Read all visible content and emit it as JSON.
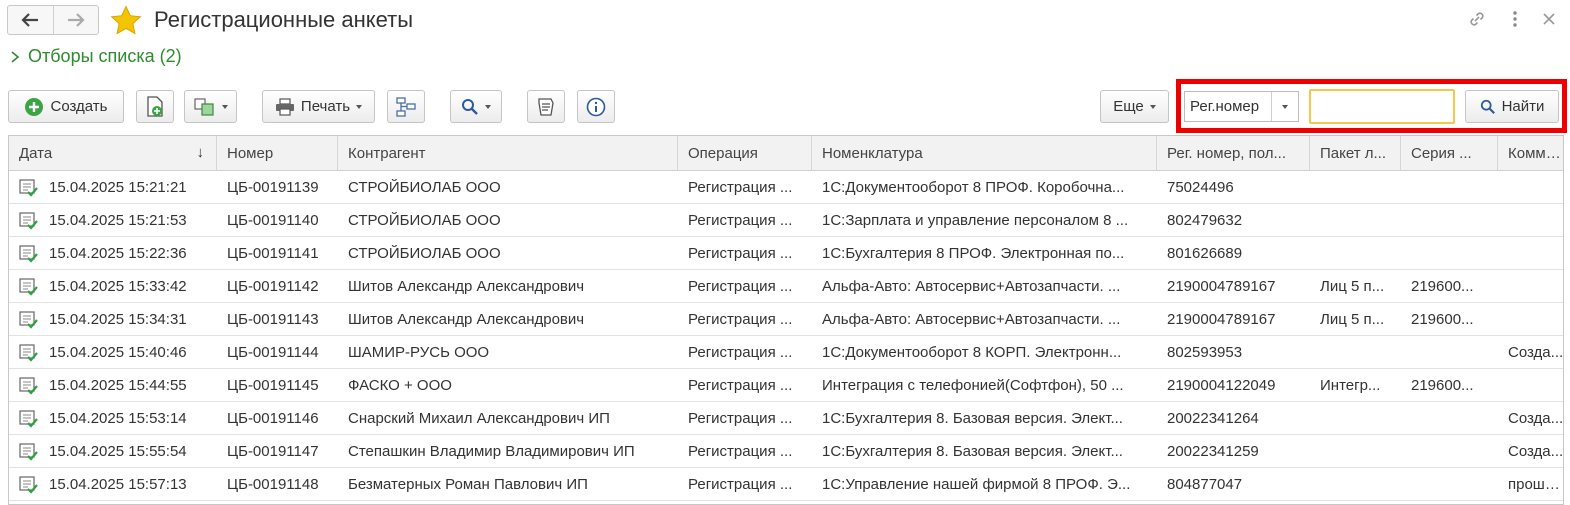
{
  "window": {
    "title": "Регистрационные анкеты",
    "filters_label": "Отборы списка (2)"
  },
  "toolbar": {
    "create_label": "Создать",
    "print_label": "Печать",
    "more_label": "Еще",
    "search_field_select": "Рег.номер",
    "search_value": "",
    "find_label": "Найти"
  },
  "table": {
    "headers": {
      "date": "Дата",
      "number": "Номер",
      "counterparty": "Контрагент",
      "operation": "Операция",
      "nomenclature": "Номенклатура",
      "regnum": "Рег. номер, пол...",
      "package": "Пакет л...",
      "series": "Серия ...",
      "comment": "Комме..."
    },
    "rows": [
      {
        "date": "15.04.2025 15:21:21",
        "number": "ЦБ-00191139",
        "counterparty": "СТРОЙБИОЛАБ ООО",
        "operation": "Регистрация ...",
        "nomenclature": "1С:Документооборот 8 ПРОФ. Коробочна...",
        "regnum": "75024496",
        "package": "",
        "series": "",
        "comment": ""
      },
      {
        "date": "15.04.2025 15:21:53",
        "number": "ЦБ-00191140",
        "counterparty": "СТРОЙБИОЛАБ ООО",
        "operation": "Регистрация ...",
        "nomenclature": "1С:Зарплата и управление персоналом 8 ...",
        "regnum": "802479632",
        "package": "",
        "series": "",
        "comment": ""
      },
      {
        "date": "15.04.2025 15:22:36",
        "number": "ЦБ-00191141",
        "counterparty": "СТРОЙБИОЛАБ ООО",
        "operation": "Регистрация ...",
        "nomenclature": "1С:Бухгалтерия 8 ПРОФ. Электронная по...",
        "regnum": "801626689",
        "package": "",
        "series": "",
        "comment": ""
      },
      {
        "date": "15.04.2025 15:33:42",
        "number": "ЦБ-00191142",
        "counterparty": "Шитов Александр Александрович",
        "operation": "Регистрация ...",
        "nomenclature": "Альфа-Авто: Автосервис+Автозапчасти. ...",
        "regnum": "2190004789167",
        "package": "Лиц 5 п...",
        "series": "219600...",
        "comment": ""
      },
      {
        "date": "15.04.2025 15:34:31",
        "number": "ЦБ-00191143",
        "counterparty": "Шитов Александр Александрович",
        "operation": "Регистрация ...",
        "nomenclature": "Альфа-Авто: Автосервис+Автозапчасти. ...",
        "regnum": "2190004789167",
        "package": "Лиц 5 п...",
        "series": "219600...",
        "comment": ""
      },
      {
        "date": "15.04.2025 15:40:46",
        "number": "ЦБ-00191144",
        "counterparty": "ШАМИР-РУСЬ ООО",
        "operation": "Регистрация ...",
        "nomenclature": "1С:Документооборот 8 КОРП. Электронн...",
        "regnum": "802593953",
        "package": "",
        "series": "",
        "comment": "Созда..."
      },
      {
        "date": "15.04.2025 15:44:55",
        "number": "ЦБ-00191145",
        "counterparty": "ФАСКО + ООО",
        "operation": "Регистрация ...",
        "nomenclature": "Интеграция с телефонией(Софтфон), 50 ...",
        "regnum": "2190004122049",
        "package": "Интегр...",
        "series": "219600...",
        "comment": ""
      },
      {
        "date": "15.04.2025 15:53:14",
        "number": "ЦБ-00191146",
        "counterparty": "Снарский Михаил Александрович ИП",
        "operation": "Регистрация ...",
        "nomenclature": "1С:Бухгалтерия 8. Базовая версия. Элект...",
        "regnum": "20022341264",
        "package": "",
        "series": "",
        "comment": "Созда..."
      },
      {
        "date": "15.04.2025 15:55:54",
        "number": "ЦБ-00191147",
        "counterparty": "Степашкин Владимир Владимирович ИП",
        "operation": "Регистрация ...",
        "nomenclature": "1С:Бухгалтерия 8. Базовая версия. Элект...",
        "regnum": "20022341259",
        "package": "",
        "series": "",
        "comment": "Созда..."
      },
      {
        "date": "15.04.2025 15:57:13",
        "number": "ЦБ-00191148",
        "counterparty": "Безматерных Роман Павлович ИП",
        "operation": "Регистрация ...",
        "nomenclature": "1С:Управление нашей фирмой 8 ПРОФ. Э...",
        "regnum": "804877047",
        "package": "",
        "series": "",
        "comment": "прошу ..."
      }
    ]
  },
  "colors": {
    "filters_green": "#2e8b2e",
    "highlight_red": "#ee0000",
    "search_focus": "#f2c94c",
    "star_yellow": "#f5c400"
  },
  "icons": {
    "back": "arrow-left-icon",
    "forward": "arrow-right-icon",
    "favorite": "star-icon",
    "link": "link-icon",
    "menu": "more-vertical-icon",
    "close": "close-icon",
    "row": "document-posted-icon"
  }
}
